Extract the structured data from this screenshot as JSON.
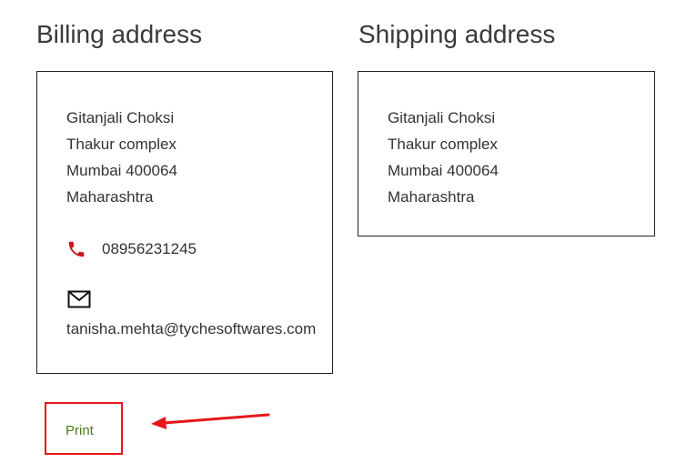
{
  "billing": {
    "heading": "Billing address",
    "name": "Gitanjali Choksi",
    "address_line": "Thakur complex",
    "city_postcode": "Mumbai 400064",
    "state": "Maharashtra",
    "phone": "08956231245",
    "email": "tanisha.mehta@tychesoftwares.com",
    "phone_icon": "phone-icon",
    "email_icon": "envelope-icon"
  },
  "shipping": {
    "heading": "Shipping address",
    "name": "Gitanjali Choksi",
    "address_line": "Thakur complex",
    "city_postcode": "Mumbai 400064",
    "state": "Maharashtra"
  },
  "actions": {
    "print_label": "Print"
  },
  "colors": {
    "text": "#333333",
    "heading": "#3a3a3a",
    "box_border": "#222222",
    "phone_icon": "#c8161d",
    "link": "#4c7a1e",
    "annotation": "#e5171b"
  }
}
